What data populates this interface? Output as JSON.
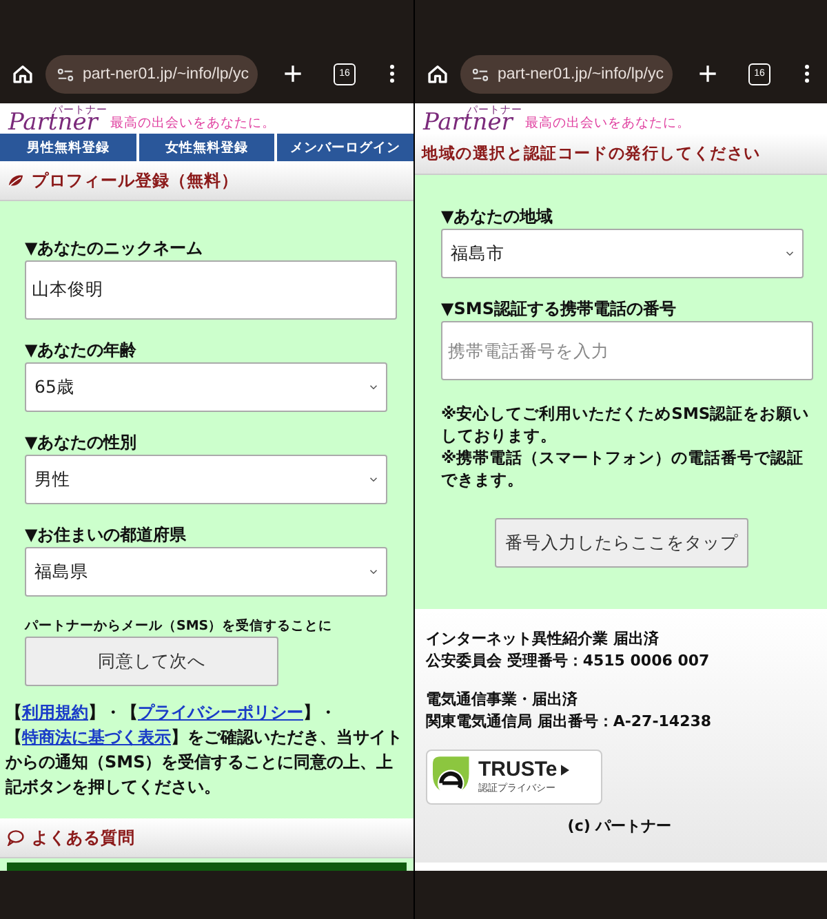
{
  "screens": [
    {
      "kind": "registration",
      "browser": {
        "url": "part-ner01.jp/~info/lp/yc",
        "tab_count": "16"
      },
      "logo": {
        "wordmark": "Partner",
        "kana": "パートナー",
        "tagline": "最高の出会いをあなたに。"
      },
      "nav": [
        "男性無料登録",
        "女性無料登録",
        "メンバーログイン"
      ],
      "section_title": "プロフィール登録（無料）",
      "fields": [
        {
          "kind": "text",
          "label": "▼あなたのニックネーム",
          "value": "山本俊明"
        },
        {
          "kind": "select",
          "label": "▼あなたの年齢",
          "value": "65歳"
        },
        {
          "kind": "select",
          "label": "▼あなたの性別",
          "value": "男性"
        },
        {
          "kind": "select",
          "label": "▼お住まいの都道府県",
          "value": "福島県"
        }
      ],
      "consent_note": "パートナーからメール（SMS）を受信することに",
      "button": "同意して次へ",
      "legal": [
        {
          "kind": "text",
          "text": "【"
        },
        {
          "kind": "link",
          "text": "利用規約"
        },
        {
          "kind": "text",
          "text": "】・【"
        },
        {
          "kind": "link",
          "text": "プライバシーポリシー"
        },
        {
          "kind": "text",
          "text": "】・【"
        },
        {
          "kind": "link",
          "text": "特商法に基づく表示"
        },
        {
          "kind": "text",
          "text": "】をご確認いただき、当サイトからの通知（SMS）を受信することに同意の上、上記ボタンを押してください。"
        }
      ],
      "faq_title": "よくある質問"
    },
    {
      "kind": "verification",
      "browser": {
        "url": "part-ner01.jp/~info/lp/yc",
        "tab_count": "16"
      },
      "logo": {
        "wordmark": "Partner",
        "kana": "パートナー",
        "tagline": "最高の出会いをあなたに。"
      },
      "section_title": "地域の選択と認証コードの発行してください",
      "fields": [
        {
          "kind": "select",
          "label": "▼あなたの地域",
          "value": "福島市"
        },
        {
          "kind": "phone",
          "label": "▼SMS認証する携帯電話の番号",
          "placeholder": "携帯電話番号を入力"
        }
      ],
      "notes": [
        "※安心してご利用いただくためSMS認証をお願いしております。",
        "※携帯電話（スマートフォン）の電話番号で認証できます。"
      ],
      "button": "番号入力したらここをタップ",
      "footer": {
        "registrations": [
          [
            "インターネット異性紹介業 届出済",
            "公安委員会 受理番号：4515 0006 007"
          ],
          [
            "電気通信事業・届出済",
            "関東電気通信局 届出番号：A-27-14238"
          ]
        ],
        "seal": {
          "wordmark": "TRUSTe",
          "caption": "認証プライバシー"
        },
        "copyright": "(c) パートナー"
      }
    }
  ]
}
